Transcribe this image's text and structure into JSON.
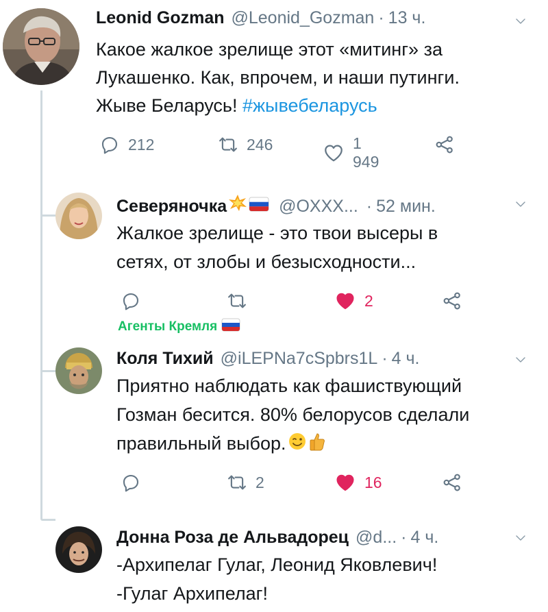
{
  "main_tweet": {
    "author_name": "Leonid Gozman",
    "handle": "@Leonid_Gozman",
    "time": "13 ч.",
    "text_line1": "Какое жалкое зрелище этот «митинг» за",
    "text_line2": "Лукашенко. Как, впрочем, и наши путинги.",
    "text_line3": "Жыве Беларусь! ",
    "hashtag": "#жывебеларусь",
    "replies": "212",
    "retweets": "246",
    "likes": "1 949"
  },
  "reply1": {
    "author_name": "Северяночка",
    "handle": "@OXXX...",
    "time": "52 мин.",
    "text_line1": "Жалкое зрелище - это твои высеры в",
    "text_line2": "сетях, от злобы и безысходности...",
    "likes": "2",
    "liked": true,
    "label": "Агенты Кремля"
  },
  "reply2": {
    "author_name": "Коля Тихий",
    "handle": "@iLEPNa7cSpbrs1L",
    "time": "4 ч.",
    "text_line1": "Приятно наблюдать как фашиствующий",
    "text_line2": "Гозман бесится. 80% белорусов сделали",
    "text_line3": "правильный выбор.",
    "retweets": "2",
    "likes": "16",
    "liked": true
  },
  "reply3": {
    "author_name": "Донна Роза де Альвадорец",
    "handle": "@d...",
    "time": "4 ч.",
    "text_line1": "-Архипелаг Гулаг,  Леонид Яковлевич!",
    "text_line2": "-Гулаг Архипелаг!"
  },
  "icons": {
    "reply": "reply-icon",
    "retweet": "retweet-icon",
    "like": "heart-icon",
    "share": "share-icon",
    "caret": "chevron-down-icon"
  },
  "colors": {
    "muted": "#657786",
    "link": "#1b95e0",
    "like": "#e0245e",
    "green": "#17bf63",
    "thread": "#cfd9de"
  }
}
